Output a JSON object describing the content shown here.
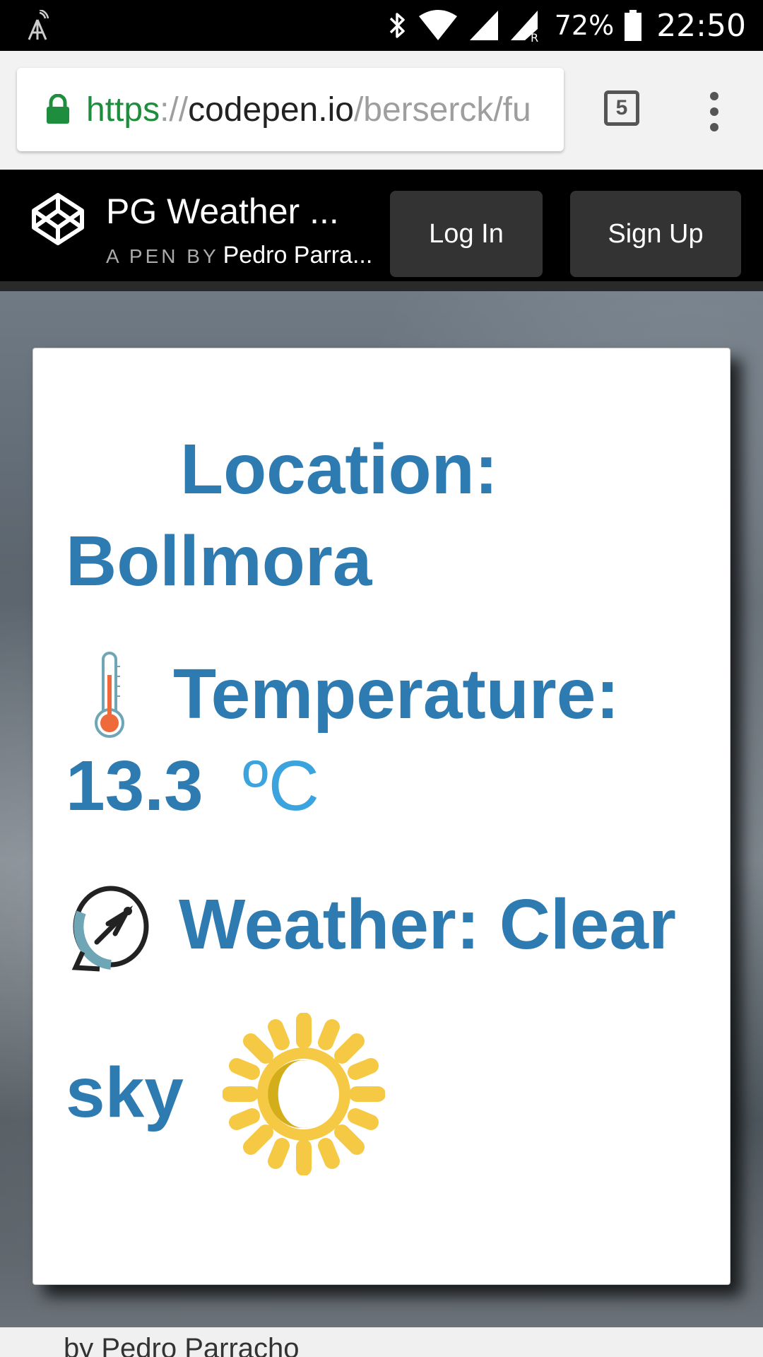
{
  "status_bar": {
    "battery_percent": "72%",
    "time": "22:50",
    "icons": [
      "signal-tower-icon",
      "bluetooth-icon",
      "wifi-icon",
      "cell-signal-icon",
      "roaming-signal-icon",
      "battery-icon"
    ]
  },
  "browser": {
    "url_scheme": "https",
    "url_sep": "://",
    "url_host": "codepen.io",
    "url_path": "/berserck/fu",
    "tab_count": "5",
    "icons": [
      "lock-icon",
      "tabs-icon",
      "overflow-menu-icon"
    ]
  },
  "codepen": {
    "pen_title": "PG Weather ...",
    "by_label": "A PEN BY",
    "author": "Pedro Parra...",
    "login_label": "Log In",
    "signup_label": "Sign Up",
    "logo_icon": "codepen-logo-icon"
  },
  "weather": {
    "location_label": "Location:",
    "location_value": "Bollmora",
    "temperature_label": "Temperature:",
    "temperature_value": "13.3",
    "temperature_unit": "ºC",
    "weather_label": "Weather: Clear",
    "weather_value": "sky",
    "icons": [
      "thermometer-icon",
      "satellite-dish-icon",
      "sun-moon-icon"
    ]
  },
  "footer": {
    "byline": "by Pedro Parracho"
  },
  "colors": {
    "text_blue": "#2e7bb2",
    "unit_blue": "#3ba3dd",
    "url_green": "#1e8e3e",
    "sun_yellow": "#f6c945"
  }
}
